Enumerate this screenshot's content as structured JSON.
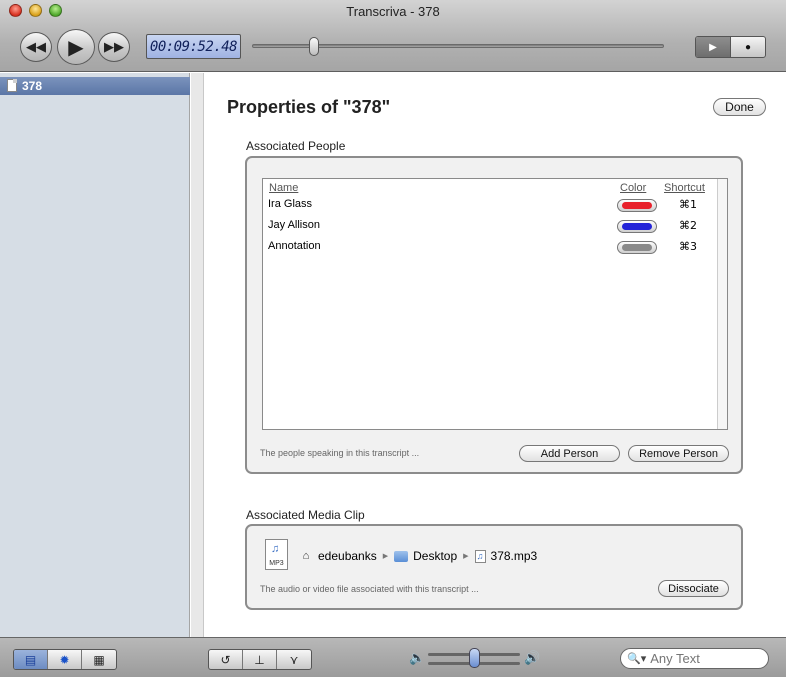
{
  "window": {
    "title": "Transcriva - 378"
  },
  "toolbar": {
    "rewind_icon": "rewind-icon",
    "play_icon": "play-icon",
    "fastforward_icon": "fast-forward-icon",
    "timecode": "00:09:52.48",
    "scrub_position_fraction": 0.15,
    "mode_play_icon": "play-icon",
    "mode_record_icon": "record-icon"
  },
  "sidebar": {
    "items": [
      {
        "label": "378",
        "icon": "document-icon",
        "selected": true
      }
    ]
  },
  "properties": {
    "title": "Properties of \"378\"",
    "done_label": "Done",
    "people": {
      "group_label": "Associated People",
      "columns": {
        "name": "Name",
        "color": "Color",
        "shortcut": "Shortcut"
      },
      "rows": [
        {
          "name": "Ira Glass",
          "color": "#e8202a",
          "shortcut": "⌘1"
        },
        {
          "name": "Jay Allison",
          "color": "#2424d8",
          "shortcut": "⌘2"
        },
        {
          "name": "Annotation",
          "color": "#8a8a8a",
          "shortcut": "⌘3"
        }
      ],
      "hint": "The people speaking in this transcript ...",
      "add_label": "Add Person",
      "remove_label": "Remove Person"
    },
    "media": {
      "group_label": "Associated Media Clip",
      "icon_label": "MP3",
      "path": [
        "edeubanks",
        "Desktop",
        "378.mp3"
      ],
      "hint": "The audio or video file associated with this transcript ...",
      "dissociate_label": "Dissociate"
    }
  },
  "bottombar": {
    "view_buttons": [
      "document-view-icon",
      "gear-icon",
      "presentation-icon"
    ],
    "edit_buttons": [
      "loop-icon",
      "split-icon",
      "merge-icon"
    ],
    "volume_fraction": 0.5,
    "search_placeholder": "Any Text"
  }
}
